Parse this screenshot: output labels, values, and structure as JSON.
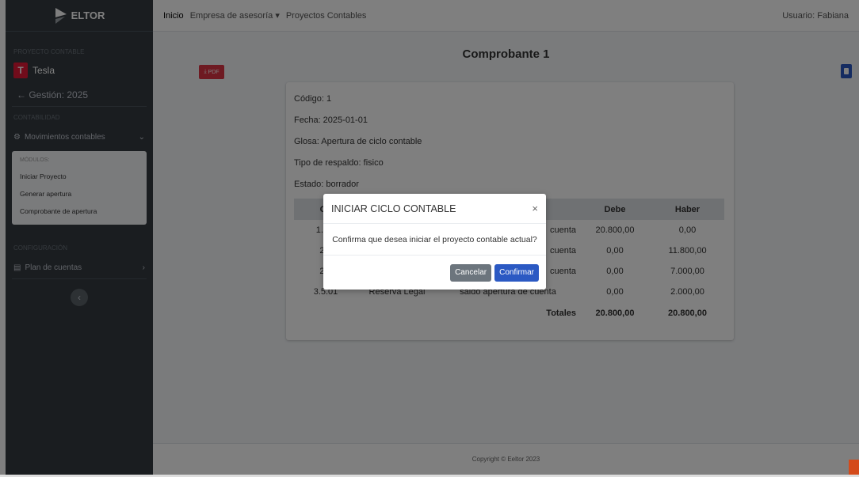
{
  "brand": {
    "name": "ELTOR"
  },
  "sidebar": {
    "section_project": "PROYECTO CONTABLE",
    "project_name": "Tesla",
    "project_badge": "T",
    "gestion": "← Gestión: 2025",
    "section_contabilidad": "CONTABILIDAD",
    "movimientos_label": "Movimientos contables",
    "submenu_head": "MÓDULOS:",
    "submenu_items": [
      "Iniciar Proyecto",
      "Generar apertura",
      "Comprobante de apertura"
    ],
    "section_config": "CONFIGURACIÓN",
    "plan_label": "Plan de cuentas"
  },
  "topnav": {
    "inicio": "Inicio",
    "empresa": "Empresa de asesoría",
    "proyectos": "Proyectos Contables",
    "user": "Usuario: Fabiana"
  },
  "page": {
    "title": "Comprobante 1",
    "pdf_label": "PDF"
  },
  "comprobante": {
    "codigo": "Código: 1",
    "fecha": "Fecha: 2025-01-01",
    "glosa": "Glosa: Apertura de ciclo contable",
    "respaldo": "Tipo de respaldo: fisico",
    "estado": "Estado: borrador"
  },
  "table": {
    "headers": [
      "Co",
      "",
      "",
      "Debe",
      "Haber"
    ],
    "rows": [
      [
        "1.1.1",
        "",
        "cuenta",
        "20.800,00",
        "0,00"
      ],
      [
        "2.2",
        "",
        "cuenta",
        "0,00",
        "11.800,00"
      ],
      [
        "2.2",
        "",
        "cuenta",
        "0,00",
        "7.000,00"
      ],
      [
        "3.5.01",
        "Reserva Legal",
        "saldo apertura de cuenta",
        "0,00",
        "2.000,00"
      ]
    ],
    "totals_label": "Totales",
    "totals_debe": "20.800,00",
    "totals_haber": "20.800,00"
  },
  "footer": {
    "text": "Copyright © Eeltor 2023"
  },
  "modal": {
    "title": "INICIAR CICLO CONTABLE",
    "close": "×",
    "body": "Confirma que desea iniciar el proyecto contable actual?",
    "cancel": "Cancelar",
    "confirm": "Confirmar"
  }
}
